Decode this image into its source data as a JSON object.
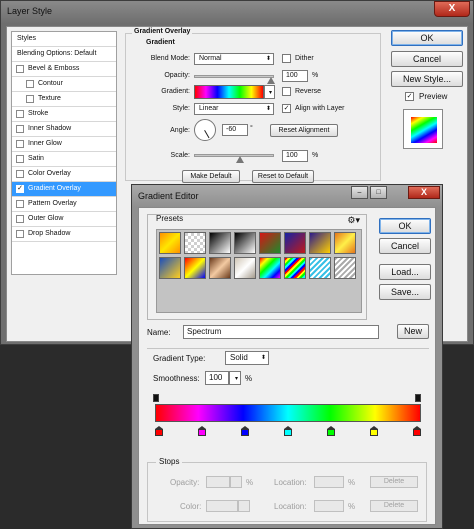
{
  "layer_style": {
    "title": "Layer Style",
    "close_glyph": "X",
    "styles_header": "Styles",
    "blending_options": "Blending Options: Default",
    "effects": [
      {
        "label": "Bevel & Emboss",
        "checked": false,
        "indent": false
      },
      {
        "label": "Contour",
        "checked": false,
        "indent": true
      },
      {
        "label": "Texture",
        "checked": false,
        "indent": true
      },
      {
        "label": "Stroke",
        "checked": false,
        "indent": false
      },
      {
        "label": "Inner Shadow",
        "checked": false,
        "indent": false
      },
      {
        "label": "Inner Glow",
        "checked": false,
        "indent": false
      },
      {
        "label": "Satin",
        "checked": false,
        "indent": false
      },
      {
        "label": "Color Overlay",
        "checked": false,
        "indent": false
      },
      {
        "label": "Gradient Overlay",
        "checked": true,
        "indent": false,
        "selected": true
      },
      {
        "label": "Pattern Overlay",
        "checked": false,
        "indent": false
      },
      {
        "label": "Outer Glow",
        "checked": false,
        "indent": false
      },
      {
        "label": "Drop Shadow",
        "checked": false,
        "indent": false
      }
    ],
    "gradient_overlay": {
      "section_title": "Gradient Overlay",
      "sub_title": "Gradient",
      "blend_mode_label": "Blend Mode:",
      "blend_mode_value": "Normal",
      "dither_label": "Dither",
      "dither_checked": false,
      "opacity_label": "Opacity:",
      "opacity_value": "100",
      "percent": "%",
      "gradient_label": "Gradient:",
      "reverse_label": "Reverse",
      "reverse_checked": false,
      "style_label": "Style:",
      "style_value": "Linear",
      "align_label": "Align with Layer",
      "align_checked": true,
      "angle_label": "Angle:",
      "angle_value": "-60",
      "degree": "°",
      "reset_alignment": "Reset Alignment",
      "scale_label": "Scale:",
      "scale_value": "100",
      "make_default": "Make Default",
      "reset_to_default": "Reset to Default"
    },
    "ok_label": "OK",
    "cancel_label": "Cancel",
    "new_style_label": "New Style...",
    "preview_label": "Preview",
    "preview_checked": true
  },
  "gradient_editor": {
    "title": "Gradient Editor",
    "minimize_glyph": "–",
    "restore_glyph": "□",
    "close_glyph": "X",
    "presets_label": "Presets",
    "gear_icon": "gear-icon",
    "presets": [
      "linear-gradient(135deg,#ff9000,#ffe600,#ff9000)",
      "repeating-conic-gradient(#ffffff 0 25%,#cfcfcf 0 50%) 0 0/6px 6px",
      "linear-gradient(135deg,#000000,#ffffff)",
      "linear-gradient(135deg,#000000,#ffffff)",
      "linear-gradient(135deg,#d51515,#1d8a2b)",
      "linear-gradient(135deg,#1523a4,#c01a1a)",
      "linear-gradient(135deg,#2c1a8c,#ffd000)",
      "linear-gradient(135deg,#e4761b,#ffef48,#e4761b)",
      "linear-gradient(135deg,#1b4fbc,#ffce1e)",
      "linear-gradient(135deg,#ff0000,#ffff00,#0000ff)",
      "linear-gradient(135deg,#6b3b1c,#f3caa2,#6b3b1c)",
      "linear-gradient(135deg,#d0c6b6,#ffffff,#a59b8c)",
      "linear-gradient(135deg,#ff0000,#ffff00,#00ff00,#00ffff,#0000ff,#ff00ff)",
      "repeating-linear-gradient(135deg,#ff0000 0 2px,#ffff00 2px 4px,#00ff00 4px 6px,#00ffff 6px 8px,#0000ff 8px 10px)",
      "repeating-linear-gradient(135deg,#38c0e6 0 2px,#ffffff 2px 4px)",
      "repeating-linear-gradient(135deg,#aaaaaa 0 2px,#ffffff 2px 4px)"
    ],
    "ok_label": "OK",
    "cancel_label": "Cancel",
    "load_label": "Load...",
    "save_label": "Save...",
    "name_label": "Name:",
    "name_value": "Spectrum",
    "new_label": "New",
    "gradient_type_label": "Gradient Type:",
    "gradient_type_value": "Solid",
    "smoothness_label": "Smoothness:",
    "smoothness_value": "100",
    "percent": "%",
    "color_stop_colors": [
      "#ff0000",
      "#ff00ff",
      "#0000ff",
      "#00ffff",
      "#00ff00",
      "#ffff00",
      "#ff0000"
    ],
    "stops_label": "Stops",
    "opacity_label": "Opacity:",
    "location_label": "Location:",
    "color_label": "Color:",
    "delete_label": "Delete"
  }
}
